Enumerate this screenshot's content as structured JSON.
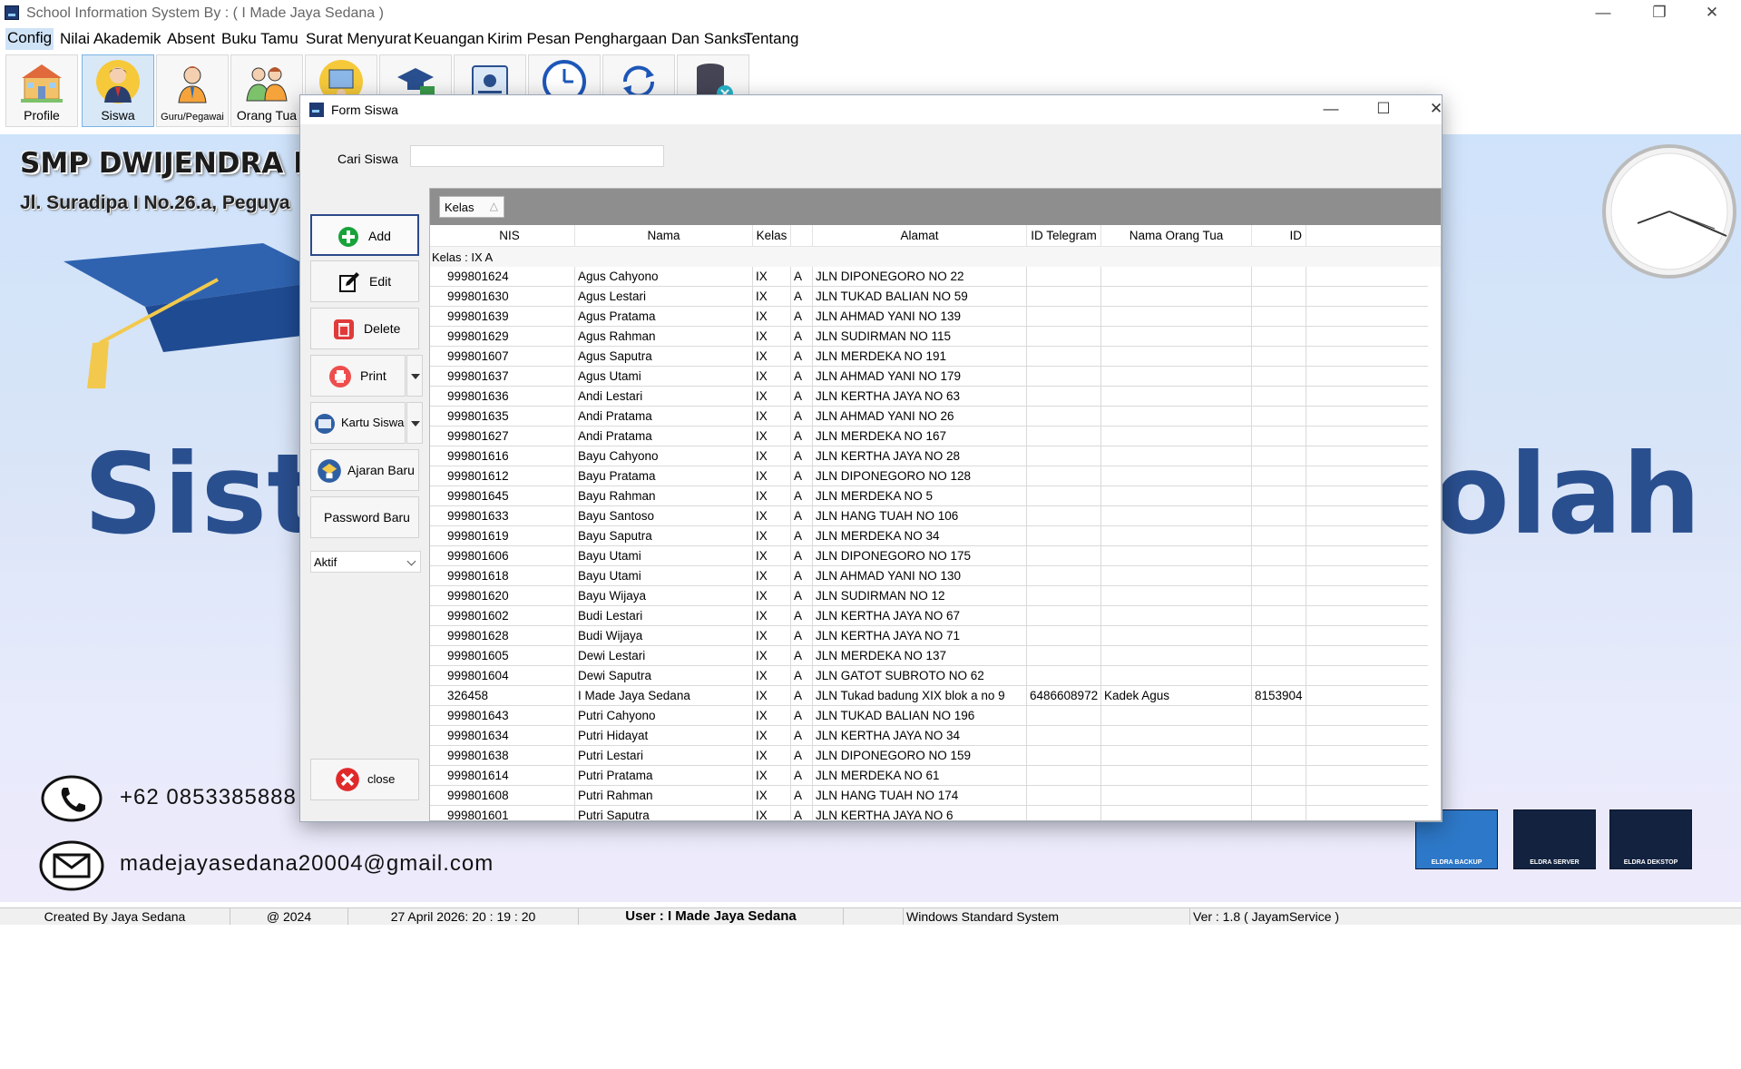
{
  "window": {
    "title": "School Information System By : ( I Made Jaya Sedana )",
    "min": "—",
    "max": "❐",
    "close": "✕"
  },
  "menu": [
    "Config",
    "Nilai Akademik",
    "Absent",
    "Buku Tamu",
    "Surat Menyurat",
    "Keuangan",
    "Kirim Pesan",
    "Penghargaan Dan Sanksi",
    "Tentang"
  ],
  "toolbar": [
    {
      "label": "Profile",
      "icon": "school-building-icon"
    },
    {
      "label": "Siswa",
      "icon": "student-icon",
      "active": true
    },
    {
      "label": "Guru/Pegawai",
      "icon": "teacher-icon"
    },
    {
      "label": "Orang Tua",
      "icon": "parents-icon"
    },
    {
      "label": "",
      "icon": "class-icon"
    },
    {
      "label": "",
      "icon": "graduation-icon"
    },
    {
      "label": "",
      "icon": "id-card-icon"
    },
    {
      "label": "",
      "icon": "clock-icon"
    },
    {
      "label": "",
      "icon": "sync-icon"
    },
    {
      "label": "",
      "icon": "database-icon"
    }
  ],
  "background": {
    "school_name": "SMP DWIJENDRA DI",
    "address": "Jl. Suradipa I No.26.a, Peguya",
    "big_left": "Sist",
    "big_right": "olah",
    "phone": "+62 0853385888",
    "email": "madejayasedana20004@gmail.com",
    "products": [
      "ELDRA BACKUP",
      "ELDRA SERVER",
      "ELDRA DEKSTOP"
    ]
  },
  "status": {
    "created": "Created By Jaya Sedana",
    "year": "@ 2024",
    "datetime": "27 April 2026: 20 : 19 : 20",
    "user": "User : I Made Jaya Sedana",
    "blank": "",
    "system": "Windows Standard System",
    "version": "Ver : 1.8 ( JayamService )"
  },
  "form": {
    "title": "Form Siswa",
    "min": "—",
    "max": "☐",
    "close": "✕",
    "search_label": "Cari Siswa",
    "search_value": "",
    "buttons": {
      "add": "Add",
      "edit": "Edit",
      "delete": "Delete",
      "print": "Print",
      "kartu": "Kartu Siswa",
      "ajaran": "Ajaran Baru",
      "password": "Password Baru",
      "close": "close"
    },
    "status_select": "Aktif",
    "group_chip": "Kelas",
    "group_sort": "△",
    "columns": [
      "NIS",
      "Nama",
      "Kelas",
      "",
      "Alamat",
      "ID Telegram",
      "Nama Orang Tua",
      "ID"
    ],
    "group_label": "Kelas : IX A",
    "rows": [
      [
        "999801624",
        "Agus Cahyono",
        "IX",
        "A",
        "JLN DIPONEGORO NO 22",
        "",
        "",
        ""
      ],
      [
        "999801630",
        "Agus Lestari",
        "IX",
        "A",
        "JLN TUKAD BALIAN NO 59",
        "",
        "",
        ""
      ],
      [
        "999801639",
        "Agus Pratama",
        "IX",
        "A",
        "JLN AHMAD YANI NO 139",
        "",
        "",
        ""
      ],
      [
        "999801629",
        "Agus Rahman",
        "IX",
        "A",
        "JLN SUDIRMAN NO 115",
        "",
        "",
        ""
      ],
      [
        "999801607",
        "Agus Saputra",
        "IX",
        "A",
        "JLN MERDEKA NO 191",
        "",
        "",
        ""
      ],
      [
        "999801637",
        "Agus Utami",
        "IX",
        "A",
        "JLN AHMAD YANI NO 179",
        "",
        "",
        ""
      ],
      [
        "999801636",
        "Andi Lestari",
        "IX",
        "A",
        "JLN KERTHA JAYA NO 63",
        "",
        "",
        ""
      ],
      [
        "999801635",
        "Andi Pratama",
        "IX",
        "A",
        "JLN AHMAD YANI NO 26",
        "",
        "",
        ""
      ],
      [
        "999801627",
        "Andi Pratama",
        "IX",
        "A",
        "JLN MERDEKA NO 167",
        "",
        "",
        ""
      ],
      [
        "999801616",
        "Bayu Cahyono",
        "IX",
        "A",
        "JLN KERTHA JAYA NO 28",
        "",
        "",
        ""
      ],
      [
        "999801612",
        "Bayu Pratama",
        "IX",
        "A",
        "JLN DIPONEGORO NO 128",
        "",
        "",
        ""
      ],
      [
        "999801645",
        "Bayu Rahman",
        "IX",
        "A",
        "JLN MERDEKA NO 5",
        "",
        "",
        ""
      ],
      [
        "999801633",
        "Bayu Santoso",
        "IX",
        "A",
        "JLN HANG TUAH NO 106",
        "",
        "",
        ""
      ],
      [
        "999801619",
        "Bayu Saputra",
        "IX",
        "A",
        "JLN MERDEKA NO 34",
        "",
        "",
        ""
      ],
      [
        "999801606",
        "Bayu Utami",
        "IX",
        "A",
        "JLN DIPONEGORO NO 175",
        "",
        "",
        ""
      ],
      [
        "999801618",
        "Bayu Utami",
        "IX",
        "A",
        "JLN AHMAD YANI NO 130",
        "",
        "",
        ""
      ],
      [
        "999801620",
        "Bayu Wijaya",
        "IX",
        "A",
        "JLN SUDIRMAN NO 12",
        "",
        "",
        ""
      ],
      [
        "999801602",
        "Budi Lestari",
        "IX",
        "A",
        "JLN KERTHA JAYA NO 67",
        "",
        "",
        ""
      ],
      [
        "999801628",
        "Budi Wijaya",
        "IX",
        "A",
        "JLN KERTHA JAYA NO 71",
        "",
        "",
        ""
      ],
      [
        "999801605",
        "Dewi Lestari",
        "IX",
        "A",
        "JLN MERDEKA NO 137",
        "",
        "",
        ""
      ],
      [
        "999801604",
        "Dewi Saputra",
        "IX",
        "A",
        "JLN GATOT SUBROTO NO 62",
        "",
        "",
        ""
      ],
      [
        "326458",
        "I Made Jaya Sedana",
        "IX",
        "A",
        "JLN Tukad badung XIX blok a no 9",
        "6486608972",
        "Kadek Agus",
        "8153904"
      ],
      [
        "999801643",
        "Putri Cahyono",
        "IX",
        "A",
        "JLN TUKAD BALIAN NO 196",
        "",
        "",
        ""
      ],
      [
        "999801634",
        "Putri Hidayat",
        "IX",
        "A",
        "JLN KERTHA JAYA NO 34",
        "",
        "",
        ""
      ],
      [
        "999801638",
        "Putri Lestari",
        "IX",
        "A",
        "JLN DIPONEGORO NO 159",
        "",
        "",
        ""
      ],
      [
        "999801614",
        "Putri Pratama",
        "IX",
        "A",
        "JLN MERDEKA NO 61",
        "",
        "",
        ""
      ],
      [
        "999801608",
        "Putri Rahman",
        "IX",
        "A",
        "JLN HANG TUAH NO 174",
        "",
        "",
        ""
      ],
      [
        "999801601",
        "Putri Saputra",
        "IX",
        "A",
        "JLN KERTHA JAYA NO 6",
        "",
        "",
        ""
      ]
    ]
  }
}
